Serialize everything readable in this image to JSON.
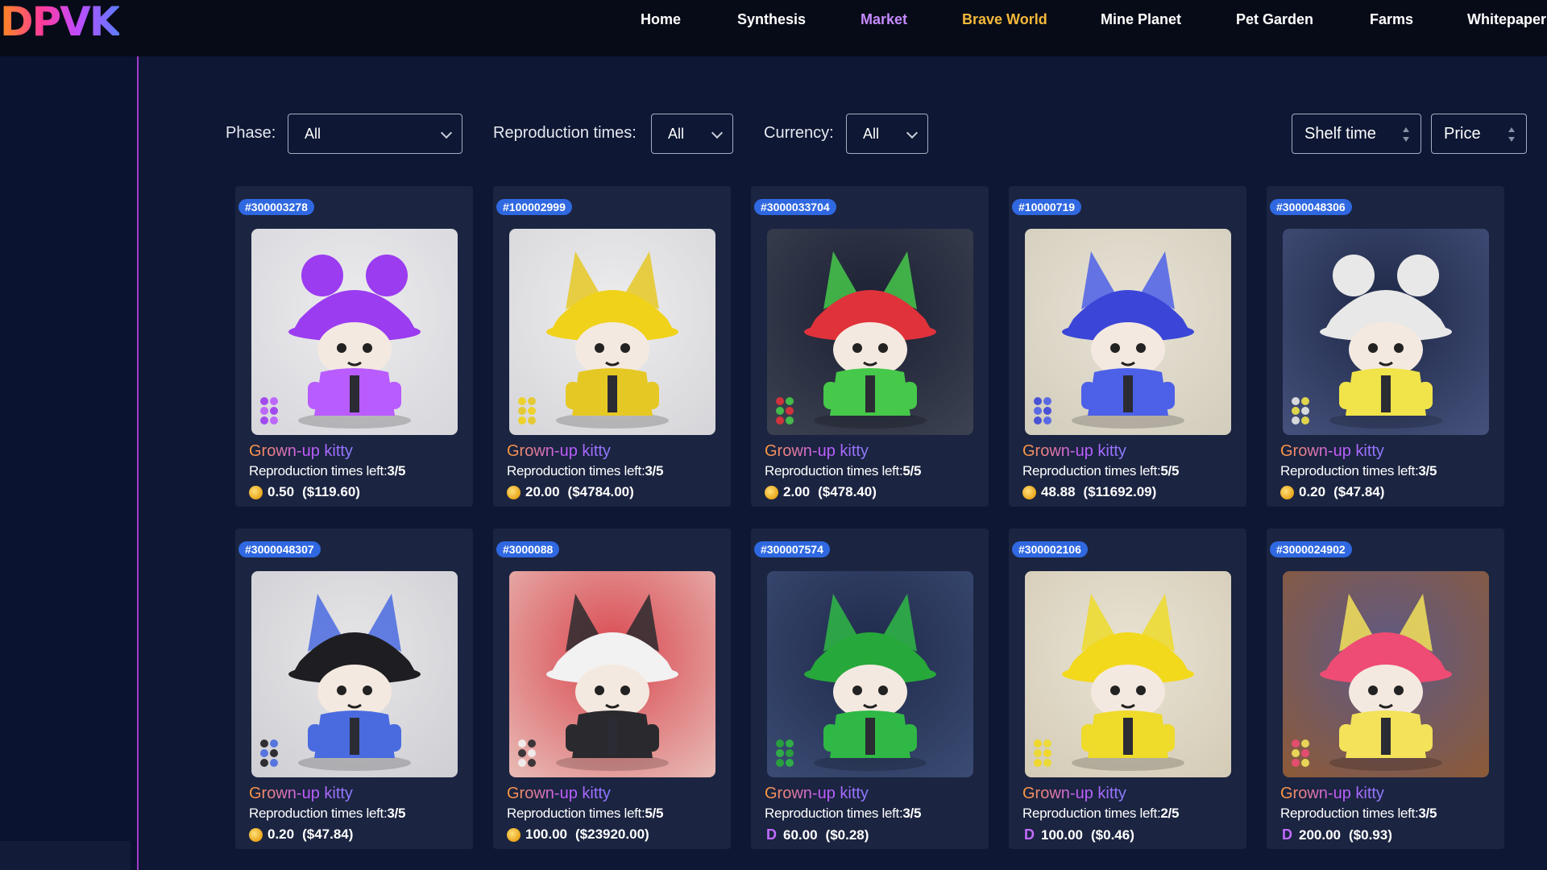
{
  "brand": {
    "logo_text": "DPVK"
  },
  "nav": {
    "items": [
      {
        "label": "Home",
        "color": "#ffffff"
      },
      {
        "label": "Synthesis",
        "color": "#ffffff"
      },
      {
        "label": "Market",
        "color": "#c58bff"
      },
      {
        "label": "Brave World",
        "color": "#f5b93a"
      },
      {
        "label": "Mine Planet",
        "color": "#ffffff"
      },
      {
        "label": "Pet Garden",
        "color": "#ffffff"
      },
      {
        "label": "Farms",
        "color": "#ffffff"
      },
      {
        "label": "Whitepaper",
        "color": "#ffffff"
      }
    ]
  },
  "filters": {
    "phase": {
      "label": "Phase:",
      "value": "All"
    },
    "reproduction": {
      "label": "Reproduction times:",
      "value": "All"
    },
    "currency": {
      "label": "Currency:",
      "value": "All"
    },
    "sort_shelf": "Shelf time",
    "sort_price": "Price"
  },
  "repro_prefix": "Reproduction times left:",
  "cards": [
    {
      "id": "#300003278",
      "name": "Grown-up kitty",
      "repro": "3/5",
      "amount": "0.50",
      "usd": "($119.60)",
      "currency": "coin",
      "hat": "#9b3cf0",
      "body": "#b95cff",
      "bg": "#ececee",
      "bg2": "#d7d7dc",
      "ears": "bear"
    },
    {
      "id": "#100002999",
      "name": "Grown-up kitty",
      "repro": "3/5",
      "amount": "20.00",
      "usd": "($4784.00)",
      "currency": "coin",
      "hat": "#f0d21a",
      "body": "#e6c825",
      "bg": "#ededee",
      "bg2": "#d6d6da",
      "ears": "cat"
    },
    {
      "id": "#3000033704",
      "name": "Grown-up kitty",
      "repro": "5/5",
      "amount": "2.00",
      "usd": "($478.40)",
      "currency": "coin",
      "hat": "#e0323b",
      "body": "#46c84a",
      "bg": "#1a1f33",
      "bg2": "#3b4150",
      "ears": "cat"
    },
    {
      "id": "#10000719",
      "name": "Grown-up kitty",
      "repro": "5/5",
      "amount": "48.88",
      "usd": "($11692.09)",
      "currency": "coin",
      "hat": "#3b46d8",
      "body": "#4d60e8",
      "bg": "#e7e2d4",
      "bg2": "#d3cdbd",
      "ears": "cat"
    },
    {
      "id": "#3000048306",
      "name": "Grown-up kitty",
      "repro": "3/5",
      "amount": "0.20",
      "usd": "($47.84)",
      "currency": "coin",
      "hat": "#e8e8e8",
      "body": "#f0e44a",
      "bg": "#1d2746",
      "bg2": "#44507a",
      "ears": "bear"
    },
    {
      "id": "#3000048307",
      "name": "Grown-up kitty",
      "repro": "3/5",
      "amount": "0.20",
      "usd": "($47.84)",
      "currency": "coin",
      "hat": "#1e1e22",
      "body": "#4a6be0",
      "bg": "#e6e6e8",
      "bg2": "#cfcfd4",
      "ears": "cat"
    },
    {
      "id": "#3000088",
      "name": "Grown-up kitty",
      "repro": "5/5",
      "amount": "100.00",
      "usd": "($23920.00)",
      "currency": "coin",
      "hat": "#f2f2f2",
      "body": "#2a2a2e",
      "bg": "#d9474f",
      "bg2": "#e7b7b2",
      "ears": "cat"
    },
    {
      "id": "#300007574",
      "name": "Grown-up kitty",
      "repro": "3/5",
      "amount": "60.00",
      "usd": "($0.28)",
      "currency": "d",
      "hat": "#27a83a",
      "body": "#2fb845",
      "bg": "#1f2a4a",
      "bg2": "#3a4a72",
      "ears": "cat"
    },
    {
      "id": "#300002106",
      "name": "Grown-up kitty",
      "repro": "2/5",
      "amount": "100.00",
      "usd": "($0.46)",
      "currency": "d",
      "hat": "#f2d91c",
      "body": "#eedb2a",
      "bg": "#e9e3d3",
      "bg2": "#d4ccb7",
      "ears": "cat"
    },
    {
      "id": "#3000024902",
      "name": "Grown-up kitty",
      "repro": "3/5",
      "amount": "200.00",
      "usd": "($0.93)",
      "currency": "d",
      "hat": "#ee4c74",
      "body": "#f3e25a",
      "bg": "#5e5a86",
      "bg2": "#8b5a3a",
      "ears": "cat"
    }
  ],
  "currency_glyph_d": "D"
}
